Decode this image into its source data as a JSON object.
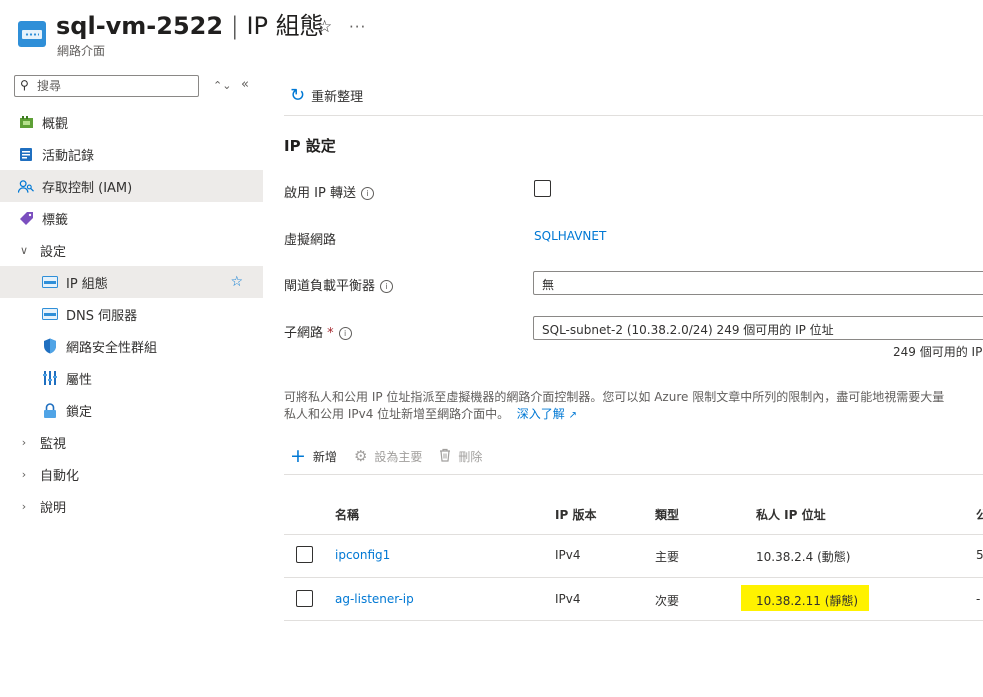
{
  "header": {
    "resource_name": "sql-vm-2522",
    "separator": "|",
    "page_name": "IP 組態",
    "subtitle": "網路介面",
    "favorite_icon": "star-icon",
    "more_icon": "ellipsis-icon"
  },
  "sidebar": {
    "search_placeholder": "搜尋",
    "items": [
      {
        "label": "概觀",
        "icon": "overview-icon"
      },
      {
        "label": "活動記錄",
        "icon": "activity-log-icon"
      },
      {
        "label": "存取控制 (IAM)",
        "icon": "iam-icon",
        "selected": true
      },
      {
        "label": "標籤",
        "icon": "tag-icon"
      },
      {
        "label": "設定",
        "icon": "chevron-down-icon",
        "expanded": true
      },
      {
        "label": "IP 組態",
        "icon": "ip-config-icon",
        "active": true
      },
      {
        "label": "DNS 伺服器",
        "icon": "dns-server-icon"
      },
      {
        "label": "網路安全性群組",
        "icon": "nsg-icon"
      },
      {
        "label": "屬性",
        "icon": "properties-icon"
      },
      {
        "label": "鎖定",
        "icon": "lock-icon"
      },
      {
        "label": "監視",
        "icon": "chevron-right-icon"
      },
      {
        "label": "自動化",
        "icon": "chevron-right-icon"
      },
      {
        "label": "說明",
        "icon": "chevron-right-icon"
      }
    ]
  },
  "toolbar": {
    "refresh_label": "重新整理"
  },
  "ip_settings": {
    "title": "IP 設定",
    "ip_forwarding_label": "啟用 IP 轉送",
    "vnet_label": "虛擬網路",
    "vnet_value": "SQLHAVNET",
    "gateway_lb_label": "閘道負載平衡器",
    "gateway_lb_value": "無",
    "subnet_label": "子網路",
    "subnet_required": "*",
    "subnet_value": "SQL-subnet-2 (10.38.2.0/24) 249 個可用的 IP 位址",
    "subnet_hint": "249 個可用的 IP"
  },
  "description": {
    "line1": "可將私人和公用 IP 位址指派至虛擬機器的網路介面控制器。您可以如 Azure 限制文章中所列的限制內，盡可能地視需要大量",
    "line2": "私人和公用 IPv4 位址新增至網路介面中。",
    "learn_more": "深入了解"
  },
  "actions": {
    "add_label": "新增",
    "set_primary_label": "設為主要",
    "delete_label": "刪除"
  },
  "table": {
    "columns": [
      "名稱",
      "IP 版本",
      "類型",
      "私人 IP 位址",
      "公"
    ],
    "rows": [
      {
        "name": "ipconfig1",
        "version": "IPv4",
        "type": "主要",
        "private_ip": "10.38.2.4 (動態)",
        "public_ip": "5",
        "highlighted": false
      },
      {
        "name": "ag-listener-ip",
        "version": "IPv4",
        "type": "次要",
        "private_ip": "10.38.2.11 (靜態)",
        "public_ip": "-",
        "highlighted": true
      }
    ]
  },
  "colors": {
    "accent": "#0078d4",
    "highlight": "#fff200",
    "selected_bg": "#edebe9"
  }
}
